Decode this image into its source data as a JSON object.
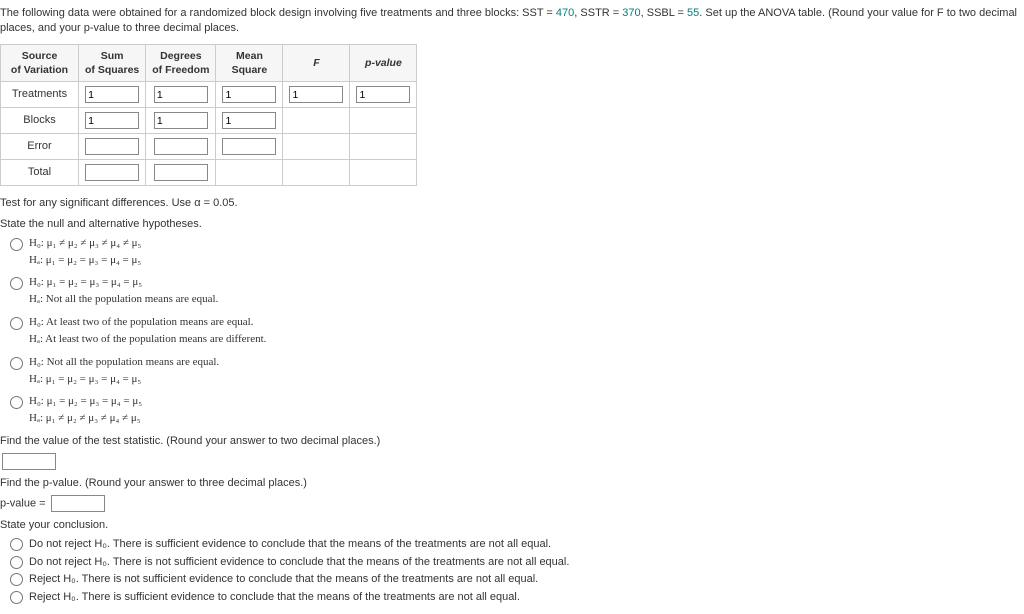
{
  "prompt": {
    "pre": "The following data were obtained for a randomized block design involving five treatments and three blocks: SST = ",
    "sst": "470",
    "mid1": ", SSTR = ",
    "sstr": "370",
    "mid2": ", SSBL = ",
    "ssbl": "55",
    "post": ". Set up the ANOVA table. (Round your value for F to two decimal places, and your p-value to three decimal places."
  },
  "table": {
    "headers": {
      "source": "Source\nof Variation",
      "ss": "Sum\nof Squares",
      "df": "Degrees\nof Freedom",
      "ms": "Mean\nSquare",
      "f": "F",
      "p": "p-value"
    },
    "rows": {
      "treatments": {
        "label": "Treatments",
        "ss": "1",
        "df": "1",
        "ms": "1",
        "f": "1",
        "p": "1"
      },
      "blocks": {
        "label": "Blocks",
        "ss": "1",
        "df": "1",
        "ms": "1"
      },
      "error": {
        "label": "Error"
      },
      "total": {
        "label": "Total"
      }
    }
  },
  "test_text": "Test for any significant differences. Use α = 0.05.",
  "state_hyp": "State the null and alternative hypotheses.",
  "hypotheses": {
    "h1": {
      "l1": "H₀: μ₁ ≠ μ₂ ≠ μ₃ ≠ μ₄ ≠ μ₅",
      "l2": "Hₐ: μ₁ = μ₂ = μ₃ = μ₄ = μ₅"
    },
    "h2": {
      "l1": "H₀: μ₁ = μ₂ = μ₃ = μ₄ = μ₅",
      "l2": "Hₐ: Not all the population means are equal."
    },
    "h3": {
      "l1": "H₀: At least two of the population means are equal.",
      "l2": "Hₐ: At least two of the population means are different."
    },
    "h4": {
      "l1": "H₀: Not all the population means are equal.",
      "l2": "Hₐ: μ₁ = μ₂ = μ₃ = μ₄ = μ₅"
    },
    "h5": {
      "l1": "H₀: μ₁ = μ₂ = μ₃ = μ₄ = μ₅",
      "l2": "Hₐ: μ₁ ≠ μ₂ ≠ μ₃ ≠ μ₄ ≠ μ₅"
    }
  },
  "find_stat": "Find the value of the test statistic. (Round your answer to two decimal places.)",
  "find_p": "Find the p-value. (Round your answer to three decimal places.)",
  "pval_label": "p-value =",
  "state_conc": "State your conclusion.",
  "conclusions": {
    "c1": "Do not reject H₀. There is sufficient evidence to conclude that the means of the treatments are not all equal.",
    "c2": "Do not reject H₀. There is not sufficient evidence to conclude that the means of the treatments are not all equal.",
    "c3": "Reject H₀. There is not sufficient evidence to conclude that the means of the treatments are not all equal.",
    "c4": "Reject H₀. There is sufficient evidence to conclude that the means of the treatments are not all equal."
  }
}
